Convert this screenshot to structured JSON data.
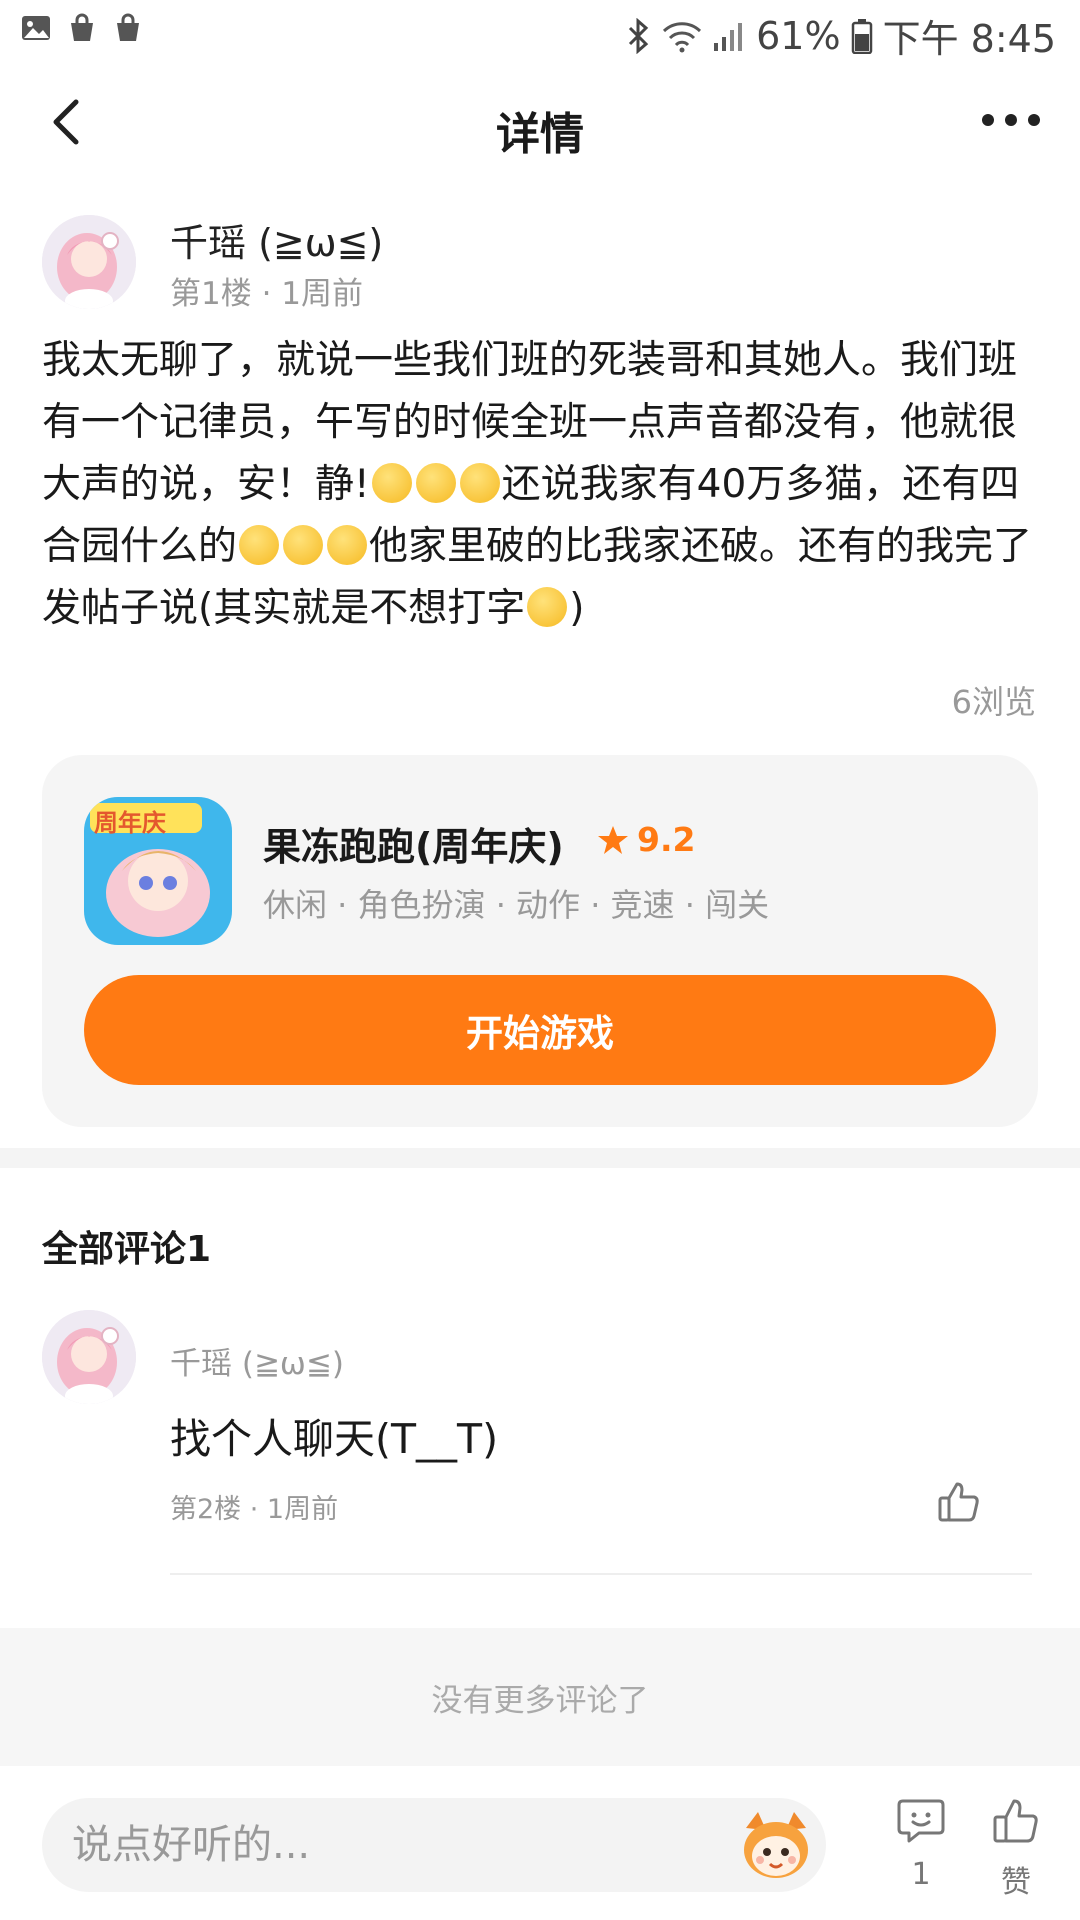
{
  "status_bar": {
    "battery_pct": "61%",
    "time": "下午 8:45"
  },
  "nav": {
    "title": "详情"
  },
  "post": {
    "author": "千瑶 (≧ω≦)",
    "meta": "第1楼 · 1周前",
    "body_seg1": "我太无聊了，就说一些我们班的死装哥和其她人。我们班有一个记律员，午写的时候全班一点声音都没有，他就很大声的说，安！静!",
    "body_seg2": "还说我家有40万多猫，还有四合园什么的",
    "body_seg3": "他家里破的比我家还破。还有的我完了发帖子说(其实就是不想打字",
    "body_seg4": ")",
    "views": "6浏览"
  },
  "game": {
    "icon_text": "周年庆",
    "name": "果冻跑跑(周年庆)",
    "rating": "9.2",
    "tags": "休闲 · 角色扮演 · 动作 · 竞速 · 闯关",
    "play_label": "开始游戏",
    "accent": "#ff7a13"
  },
  "comments": {
    "title": "全部评论1",
    "items": [
      {
        "author": "千瑶 (≧ω≦)",
        "text": "找个人聊天(T__T)",
        "meta": "第2楼 · 1周前"
      }
    ],
    "no_more": "没有更多评论了"
  },
  "bottom_bar": {
    "input_placeholder": "说点好听的...",
    "comment_count": "1",
    "like_label": "赞"
  }
}
